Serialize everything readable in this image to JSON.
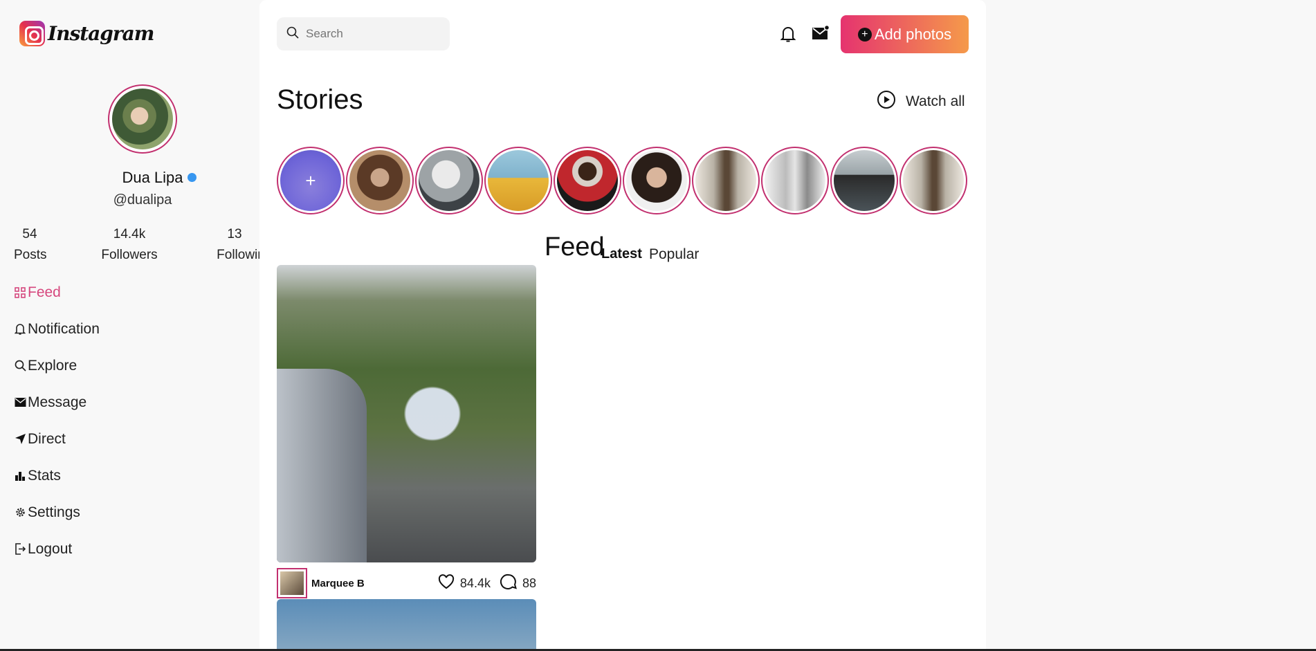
{
  "app": {
    "logo_text": "Instagram"
  },
  "profile": {
    "name": "Dua Lipa",
    "handle": "@dualipa",
    "stats": [
      {
        "value": "54",
        "label": "Posts"
      },
      {
        "value": "14.4k",
        "label": "Followers"
      },
      {
        "value": "13",
        "label": "Followin"
      }
    ]
  },
  "nav": [
    {
      "label": "Feed",
      "icon": "grid-icon",
      "active": true
    },
    {
      "label": "Notification",
      "icon": "bell-icon"
    },
    {
      "label": "Explore",
      "icon": "search-icon"
    },
    {
      "label": "Message",
      "icon": "mail-icon"
    },
    {
      "label": "Direct",
      "icon": "send-icon"
    },
    {
      "label": "Stats",
      "icon": "bar-chart-icon"
    },
    {
      "label": "Settings",
      "icon": "gear-icon"
    },
    {
      "label": "Logout",
      "icon": "logout-icon"
    }
  ],
  "header": {
    "search_placeholder": "Search",
    "add_photos_label": "Add photos"
  },
  "stories": {
    "title": "Stories",
    "watch_all_label": "Watch all",
    "add_symbol": "+"
  },
  "feed": {
    "title": "Feed",
    "tabs": [
      "Latest",
      "Popular"
    ],
    "post": {
      "user": "Marquee B",
      "likes": "84.4k",
      "comments": "88"
    }
  },
  "colors": {
    "accent_pink": "#d6487e",
    "ring": "#c2306f",
    "button_start": "#e5336f",
    "button_end": "#f59a4a"
  }
}
